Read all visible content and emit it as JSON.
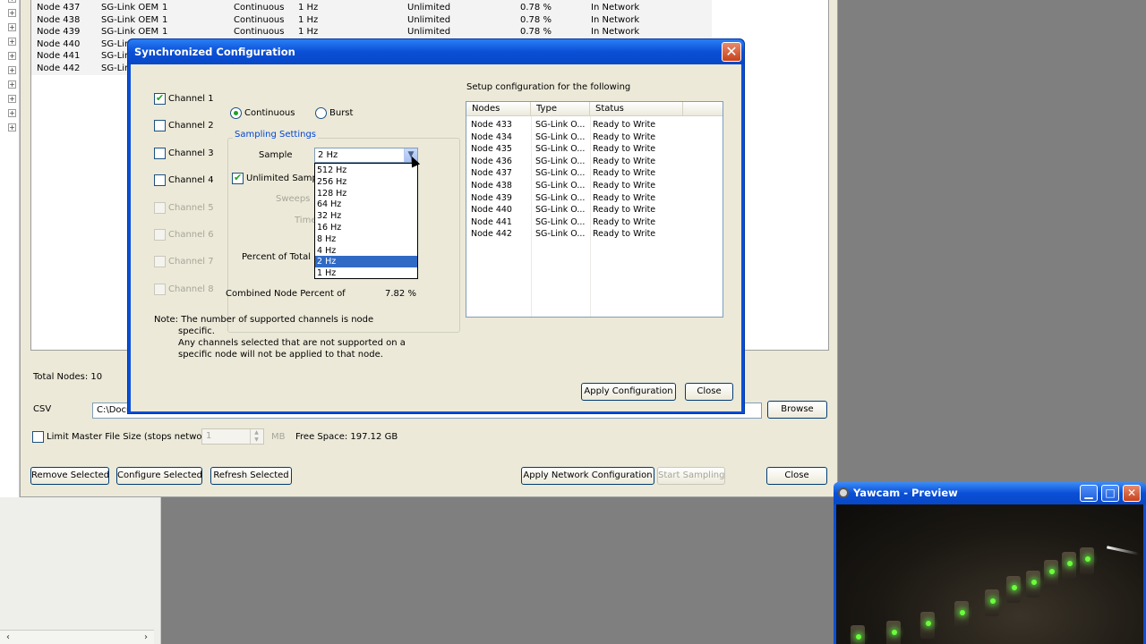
{
  "grid": {
    "rows": [
      {
        "node": "Node 437",
        "model": "SG-Link OEM",
        "ch": "1",
        "mode": "Continuous",
        "rate": "1 Hz",
        "dur": "Unlimited",
        "pct": "0.78 %",
        "status": "In Network"
      },
      {
        "node": "Node 438",
        "model": "SG-Link OEM",
        "ch": "1",
        "mode": "Continuous",
        "rate": "1 Hz",
        "dur": "Unlimited",
        "pct": "0.78 %",
        "status": "In Network"
      },
      {
        "node": "Node 439",
        "model": "SG-Link OEM",
        "ch": "1",
        "mode": "Continuous",
        "rate": "1 Hz",
        "dur": "Unlimited",
        "pct": "0.78 %",
        "status": "In Network"
      },
      {
        "node": "Node 440",
        "model": "SG-Link",
        "ch": "",
        "mode": "",
        "rate": "",
        "dur": "",
        "pct": "",
        "status": ""
      },
      {
        "node": "Node 441",
        "model": "SG-Link",
        "ch": "",
        "mode": "",
        "rate": "",
        "dur": "",
        "pct": "",
        "status": ""
      },
      {
        "node": "Node 442",
        "model": "SG-Link",
        "ch": "",
        "mode": "",
        "rate": "",
        "dur": "",
        "pct": "",
        "status": ""
      }
    ]
  },
  "main": {
    "total_nodes": "Total Nodes: 10",
    "csv_label": "CSV",
    "csv_path": "C:\\Docu",
    "browse": "Browse",
    "limit_label": "Limit Master File Size (stops network)",
    "limit_value": "1",
    "mb": "MB",
    "free_space": "Free Space:  197.12 GB",
    "buttons": {
      "remove": "Remove Selected",
      "configure": "Configure Selected",
      "refresh": "Refresh Selected",
      "apply_network": "Apply Network Configuration",
      "start": "Start Sampling",
      "close": "Close"
    }
  },
  "dialog": {
    "title": "Synchronized Configuration",
    "close_glyph": "✕",
    "channels": [
      {
        "label": "Channel 1",
        "checked": true,
        "enabled": true
      },
      {
        "label": "Channel 2",
        "checked": false,
        "enabled": true
      },
      {
        "label": "Channel 3",
        "checked": false,
        "enabled": true
      },
      {
        "label": "Channel 4",
        "checked": false,
        "enabled": true
      },
      {
        "label": "Channel 5",
        "checked": false,
        "enabled": false
      },
      {
        "label": "Channel 6",
        "checked": false,
        "enabled": false
      },
      {
        "label": "Channel 7",
        "checked": false,
        "enabled": false
      },
      {
        "label": "Channel 8",
        "checked": false,
        "enabled": false
      }
    ],
    "mode": {
      "continuous": "Continuous",
      "burst": "Burst",
      "selected": "Continuous"
    },
    "sampling_title": "Sampling Settings",
    "sample_label": "Sample",
    "sample_value": "2 Hz",
    "unlimited_label": "Unlimited Sample",
    "sweeps_label": "Sweeps",
    "time_label": "Time",
    "percent_label": "Percent of Total",
    "combined_label": "Combined Node Percent of",
    "combined_value": "7.82 %",
    "rate_options": [
      "512 Hz",
      "256 Hz",
      "128 Hz",
      "64 Hz",
      "32 Hz",
      "16 Hz",
      "8 Hz",
      "4 Hz",
      "2 Hz",
      "1 Hz"
    ],
    "selected_rate": "2 Hz",
    "setup_label": "Setup configuration for the following",
    "list_headers": [
      "Nodes",
      "Type",
      "Status"
    ],
    "list_rows": [
      [
        "Node 433",
        "SG-Link O...",
        "Ready to Write"
      ],
      [
        "Node 434",
        "SG-Link O...",
        "Ready to Write"
      ],
      [
        "Node 435",
        "SG-Link O...",
        "Ready to Write"
      ],
      [
        "Node 436",
        "SG-Link O...",
        "Ready to Write"
      ],
      [
        "Node 437",
        "SG-Link O...",
        "Ready to Write"
      ],
      [
        "Node 438",
        "SG-Link O...",
        "Ready to Write"
      ],
      [
        "Node 439",
        "SG-Link O...",
        "Ready to Write"
      ],
      [
        "Node 440",
        "SG-Link O...",
        "Ready to Write"
      ],
      [
        "Node 441",
        "SG-Link O...",
        "Ready to Write"
      ],
      [
        "Node 442",
        "SG-Link O...",
        "Ready to Write"
      ]
    ],
    "note_lines": [
      "Note: The number of supported channels is node",
      "specific.",
      "Any channels selected that are not supported on a",
      "specific node will not be applied to that node."
    ],
    "apply": "Apply Configuration",
    "close": "Close"
  },
  "yawcam": {
    "title": "Yawcam - Preview",
    "minimize": "▁",
    "maximize": "□",
    "close": "✕"
  },
  "colors": {
    "titlebar": "#0a4fd6",
    "dialog_bg": "#ece9d8",
    "selection": "#316ac5",
    "check": "#21a121"
  }
}
